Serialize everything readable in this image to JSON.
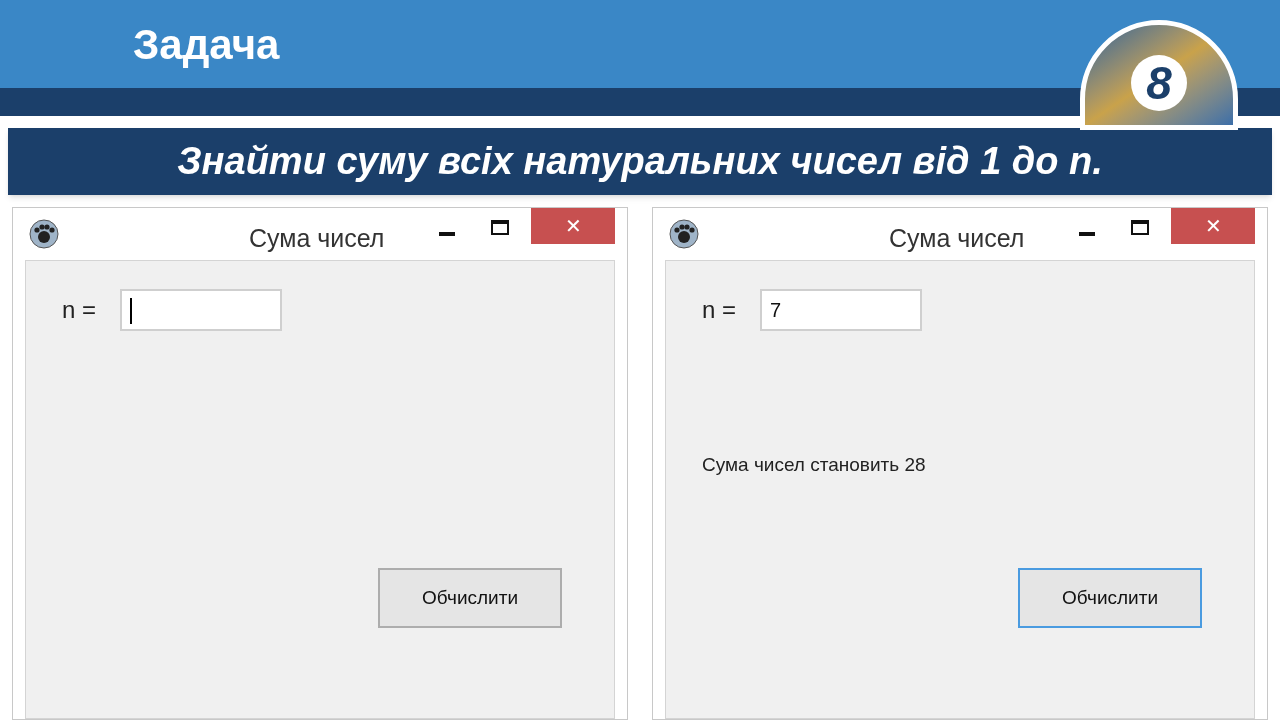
{
  "slide": {
    "title": "Задача",
    "logo_number": "8",
    "task": "Знайти суму всіх натуральних чисел від 1 до n."
  },
  "windows": [
    {
      "title": "Сума чисел",
      "close_glyph": "✕",
      "n_label": "n =",
      "caret": true,
      "button": "Обчислити",
      "button_focused": false
    },
    {
      "title": "Сума чисел",
      "close_glyph": "✕",
      "n_label": "n =",
      "n_value": "7",
      "caret": false,
      "result": "Сума чисел становить 28",
      "button": "Обчислити",
      "button_focused": true
    }
  ]
}
